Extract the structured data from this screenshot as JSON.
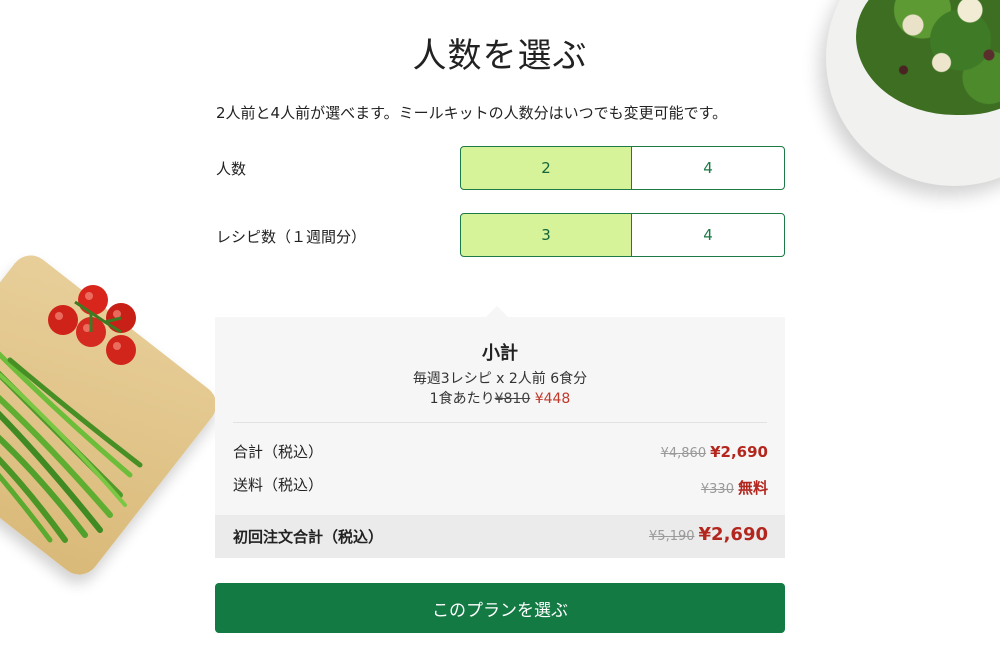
{
  "page": {
    "title": "人数を選ぶ",
    "description": "2人前と4人前が選べます。ミールキットの人数分はいつでも変更可能です。"
  },
  "servings": {
    "label": "人数",
    "options": [
      "2",
      "4"
    ],
    "selected": "2"
  },
  "recipes": {
    "label": "レシピ数（１週間分）",
    "options": [
      "3",
      "4"
    ],
    "selected": "3"
  },
  "summary": {
    "title": "小計",
    "plan_line": "毎週3レシピ x 2人前 6食分",
    "per_meal_prefix": "1食あたり",
    "per_meal_old": "¥810",
    "per_meal_new": "¥448",
    "subtotal_label": "合計（税込）",
    "subtotal_old": "¥4,860",
    "subtotal_new": "¥2,690",
    "shipping_label": "送料（税込）",
    "shipping_old": "¥330",
    "shipping_new": "無料",
    "total_label": "初回注文合計（税込）",
    "total_old": "¥5,190",
    "total_new": "¥2,690"
  },
  "cta": {
    "label": "このプランを選ぶ"
  },
  "colors": {
    "brand_green": "#137a44",
    "selected_bg": "#d6f39a",
    "price_red": "#b3261e",
    "summary_bg": "#f6f6f6"
  },
  "images": {
    "top_right": "salad-plate",
    "left": "green-beans-on-board",
    "left_top": "cherry-tomatoes"
  }
}
